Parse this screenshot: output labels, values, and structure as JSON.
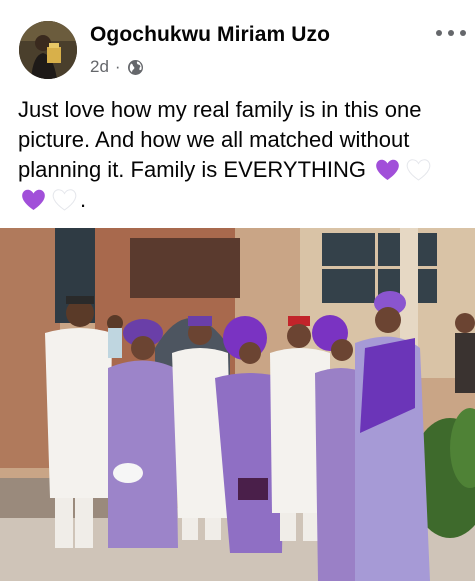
{
  "post": {
    "author": "Ogochukwu Miriam Uzo",
    "time": "2d",
    "separator": "·",
    "privacy_icon": "globe-icon",
    "more_icon": "more-options-icon",
    "text_parts": {
      "line": "Just love how my real family is in this one picture. And how we all matched without planning it. Family is EVERYTHING",
      "trailing": "."
    },
    "emojis": [
      "purple-heart",
      "white-heart",
      "purple-heart",
      "white-heart"
    ],
    "photo_alt_icon": "family-photo"
  },
  "colors": {
    "text": "#050505",
    "secondary": "#65676b",
    "purple_heart": "#a14fd9"
  }
}
